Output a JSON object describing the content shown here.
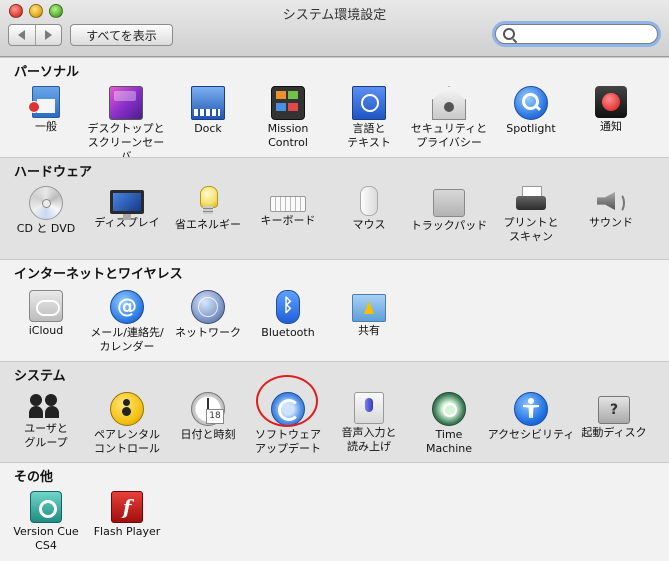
{
  "window": {
    "title": "システム環境設定"
  },
  "toolbar": {
    "show_all_label": "すべてを表示",
    "search_placeholder": ""
  },
  "sections": {
    "personal": {
      "title": "パーソナル",
      "items": [
        {
          "label": "一般",
          "icon": "general-icon"
        },
        {
          "label": "デスクトップと\nスクリーンセーバ",
          "icon": "desktop-screensaver-icon"
        },
        {
          "label": "Dock",
          "icon": "dock-icon"
        },
        {
          "label": "Mission\nControl",
          "icon": "mission-control-icon"
        },
        {
          "label": "言語と\nテキスト",
          "icon": "language-text-icon"
        },
        {
          "label": "セキュリティと\nプライバシー",
          "icon": "security-privacy-icon"
        },
        {
          "label": "Spotlight",
          "icon": "spotlight-icon"
        },
        {
          "label": "通知",
          "icon": "notifications-icon"
        }
      ]
    },
    "hardware": {
      "title": "ハードウェア",
      "items": [
        {
          "label": "CD と DVD",
          "icon": "cd-dvd-icon"
        },
        {
          "label": "ディスプレイ",
          "icon": "display-icon"
        },
        {
          "label": "省エネルギー",
          "icon": "energy-saver-icon"
        },
        {
          "label": "キーボード",
          "icon": "keyboard-icon"
        },
        {
          "label": "マウス",
          "icon": "mouse-icon"
        },
        {
          "label": "トラックパッド",
          "icon": "trackpad-icon"
        },
        {
          "label": "プリントと\nスキャン",
          "icon": "printer-icon"
        },
        {
          "label": "サウンド",
          "icon": "sound-icon"
        }
      ]
    },
    "internet": {
      "title": "インターネットとワイヤレス",
      "items": [
        {
          "label": "iCloud",
          "icon": "icloud-icon"
        },
        {
          "label": "メール/連絡先/\nカレンダー",
          "icon": "mail-contacts-calendar-icon",
          "glyph": "@"
        },
        {
          "label": "ネットワーク",
          "icon": "network-icon"
        },
        {
          "label": "Bluetooth",
          "icon": "bluetooth-icon",
          "glyph": "ᛒ"
        },
        {
          "label": "共有",
          "icon": "sharing-icon"
        }
      ]
    },
    "system": {
      "title": "システム",
      "items": [
        {
          "label": "ユーザと\nグループ",
          "icon": "users-groups-icon"
        },
        {
          "label": "ペアレンタル\nコントロール",
          "icon": "parental-controls-icon"
        },
        {
          "label": "日付と時刻",
          "icon": "date-time-icon"
        },
        {
          "label": "ソフトウェア\nアップデート",
          "icon": "software-update-icon"
        },
        {
          "label": "音声入力と\n読み上げ",
          "icon": "dictation-speech-icon"
        },
        {
          "label": "Time\nMachine",
          "icon": "time-machine-icon"
        },
        {
          "label": "アクセシビリティ",
          "icon": "accessibility-icon"
        },
        {
          "label": "起動ディスク",
          "icon": "startup-disk-icon",
          "glyph": "?"
        }
      ]
    },
    "other": {
      "title": "その他",
      "items": [
        {
          "label": "Version Cue\nCS4",
          "icon": "version-cue-icon"
        },
        {
          "label": "Flash Player",
          "icon": "flash-player-icon",
          "glyph": "f"
        }
      ]
    }
  },
  "colors": {
    "highlight_ring": "#e01e1e",
    "search_focus": "#8fb4e8"
  }
}
